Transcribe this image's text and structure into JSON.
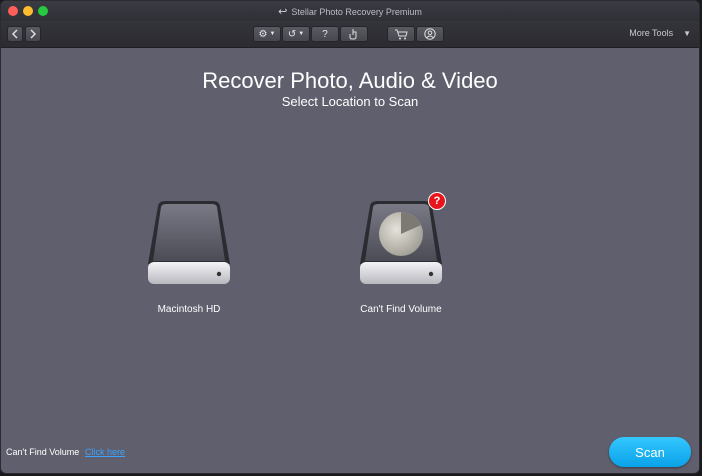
{
  "window": {
    "title": "Stellar Photo Recovery Premium"
  },
  "toolbar": {
    "back_icon": "chevron-left-icon",
    "forward_icon": "chevron-right-icon",
    "settings_icon": "gear-icon",
    "history_icon": "history-icon",
    "help_label": "?",
    "activate_icon": "hand-pointer-icon",
    "cart_icon": "cart-icon",
    "account_icon": "user-icon",
    "more_tools_label": "More Tools"
  },
  "main": {
    "heading": "Recover Photo, Audio & Video",
    "subheading": "Select Location to Scan",
    "drives": [
      {
        "label": "Macintosh HD"
      },
      {
        "label": "Can't Find Volume",
        "badge": "?"
      }
    ]
  },
  "footer": {
    "prompt": "Can't Find Volume",
    "link": "Click here",
    "scan_label": "Scan"
  },
  "colors": {
    "accent": "#0aa2e8",
    "background": "#5f5f6e",
    "badge": "#e8141c"
  }
}
